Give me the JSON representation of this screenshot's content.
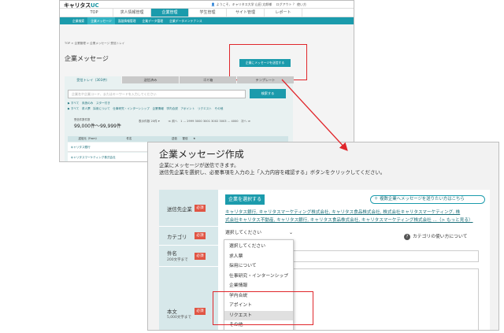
{
  "back": {
    "logo_main": "キャリタス",
    "logo_suffix": "UC",
    "userbar": "👤 ようこそ、キャリタス大学 山田 太郎様　  ログアウト  ？ 使い方",
    "nav1": [
      "TOP",
      "求人情報管理",
      "企業管理",
      "学生管理",
      "サイト管理",
      "レポート"
    ],
    "nav1_active": 2,
    "nav2": [
      "企業検索",
      "企業メッセージ",
      "面談情報管理",
      "企業データ管理",
      "企業データメンテナンス"
    ],
    "nav2_selected": 1,
    "breadcrumb": "TOP > 企業管理 > 企業メッセージ 受信トレイ",
    "page_title": "企業メッセージ",
    "send_button": "企業にメッセージを送信する",
    "tabs": [
      "受信トレイ（303件）",
      "送信済み",
      "ゴミ箱",
      "テンプレート"
    ],
    "search_placeholder": "企業名や企業コード、またはキーワードを入力してください",
    "search_button": "検索する",
    "filter1": "▶ すべて　未読のみ　スター付き",
    "filter2": "▶ すべて　求人票　採用について　仕事研究・インターンシップ　企業情報　学内合説　アポイント　リクエスト　その他",
    "count_label": "受信件数件数",
    "range": "99,000件～99,999件",
    "pager": "表示件数 20件 ▾　　　≪ 前へ　1 … 2999 3000 3001 3002 3003 … 4000　次へ ≫",
    "table_header": "　　　　送信元（From）　　　　　　　　　　　件名　　　　　　　　　　　　　　　送信　　配信　　★",
    "rows": [
      "　キャリタス銀行",
      "　キャリタスマーケティング株式会社"
    ]
  },
  "front": {
    "title": "企業メッセージ作成",
    "desc1": "企業にメッセージが送信できます。",
    "desc2": "送信先企業を選択し、必要事項を入力の上「入力内容を確認する」ボタンをクリックしてください。",
    "label_dest": "送信先企業",
    "label_category": "カテゴリ",
    "label_subject": "件名",
    "label_subject_sub": "200文字まで",
    "label_body": "本文",
    "label_body_sub": "5,000文字まで",
    "required": "必須",
    "select_company_button": "企業を選択する",
    "multi_send_link": "＋ 複数企業へメッセージを送りたい方はこちら",
    "companies_line1": "キャリタス銀行,  キャリタスマーケティング株式会社,  キャリタス食品株式会社,  株式会社キャリタスマーケティング,  株",
    "companies_line2": "式会社キャリタス不動産,  キャリタス銀行,  キャリタス食品株式会社,  キャリタスマーケティング株式会社 ...（> もっと見る）",
    "dropdown_value": "選択してください",
    "category_help": "カテゴリの使い方について",
    "category_options": [
      "選択してください",
      "求人票",
      "採用について",
      "仕事研究・インターンシップ",
      "企業情報",
      "学内合説",
      "アポイント",
      "リクエスト",
      "その他"
    ],
    "highlighted_option": 7
  },
  "colors": {
    "teal": "#1b9bac",
    "highlight_red": "#e0262b",
    "required_red": "#e05544"
  }
}
